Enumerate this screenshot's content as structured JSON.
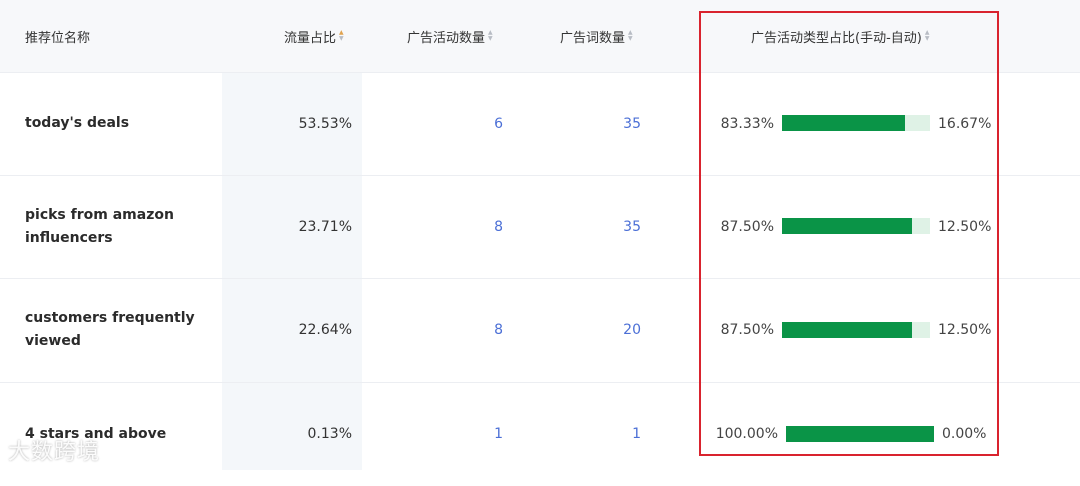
{
  "header": {
    "col_name": "推荐位名称",
    "col_traffic": "流量占比",
    "col_campaigns": "广告活动数量",
    "col_keywords": "广告词数量",
    "col_type_ratio": "广告活动类型占比(手动-自动)"
  },
  "rows": [
    {
      "name": "today's deals",
      "traffic": "53.53%",
      "campaigns": "6",
      "keywords": "35",
      "manual": "83.33%",
      "auto": "16.67%",
      "manual_fraction": 0.8333
    },
    {
      "name": "picks from amazon influencers",
      "traffic": "23.71%",
      "campaigns": "8",
      "keywords": "35",
      "manual": "87.50%",
      "auto": "12.50%",
      "manual_fraction": 0.875
    },
    {
      "name": "customers frequently viewed",
      "traffic": "22.64%",
      "campaigns": "8",
      "keywords": "20",
      "manual": "87.50%",
      "auto": "12.50%",
      "manual_fraction": 0.875
    },
    {
      "name": "4 stars and above",
      "traffic": "0.13%",
      "campaigns": "1",
      "keywords": "1",
      "manual": "100.00%",
      "auto": "0.00%",
      "manual_fraction": 1.0
    }
  ],
  "watermark": "大数跨境",
  "colors": {
    "bar_manual": "#0a9447",
    "bar_auto": "#dff2e6",
    "link": "#4b6fd6",
    "highlight_box": "#d9232e"
  }
}
